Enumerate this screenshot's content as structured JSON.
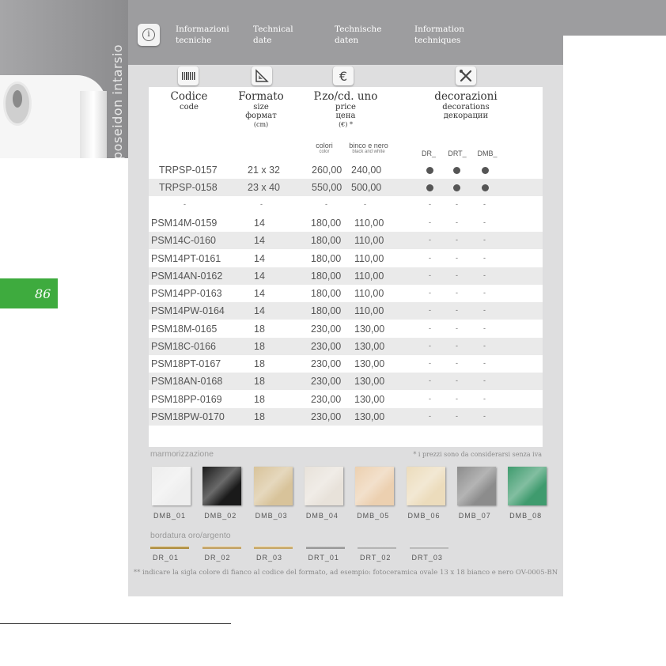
{
  "side": {
    "title": "poseidon intarsio"
  },
  "header": {
    "labels": [
      {
        "line1": "Informazioni",
        "line2": "tecniche"
      },
      {
        "line1": "Technical",
        "line2": "date"
      },
      {
        "line1": "Technische",
        "line2": "daten"
      },
      {
        "line1": "Information",
        "line2": "techniques"
      }
    ]
  },
  "columns": {
    "code": {
      "title": "Codice",
      "sub1": "code"
    },
    "format": {
      "title": "Formato",
      "sub1": "size",
      "sub2": "формат",
      "sub3": "(cm)"
    },
    "price": {
      "title": "P.zo/cd. uno",
      "sub1": "price",
      "sub2": "цена",
      "sub3": "(€) *",
      "colors_label": "colori",
      "colors_sub": "color",
      "bw_label": "binco e nero",
      "bw_sub": "black and white"
    },
    "decor": {
      "title": "decorazioni",
      "sub1": "decorations",
      "sub2": "декорации",
      "dr": "DR_",
      "drt": "DRT_",
      "dmb": "DMB_"
    }
  },
  "rows_top": [
    {
      "code": "TRPSP-0157",
      "size": "21 x 32",
      "color": "260,00",
      "bw": "240,00",
      "dr": true,
      "drt": true,
      "dmb": true
    },
    {
      "code": "TRPSP-0158",
      "size": "23 x 40",
      "color": "550,00",
      "bw": "500,00",
      "dr": true,
      "drt": true,
      "dmb": true
    }
  ],
  "dash": "-",
  "rows": [
    {
      "code": "PSM14M-0159",
      "size": "14",
      "color": "180,00",
      "bw": "110,00"
    },
    {
      "code": "PSM14C-0160",
      "size": "14",
      "color": "180,00",
      "bw": "110,00"
    },
    {
      "code": "PSM14PT-0161",
      "size": "14",
      "color": "180,00",
      "bw": "110,00"
    },
    {
      "code": "PSM14AN-0162",
      "size": "14",
      "color": "180,00",
      "bw": "110,00"
    },
    {
      "code": "PSM14PP-0163",
      "size": "14",
      "color": "180,00",
      "bw": "110,00"
    },
    {
      "code": "PSM14PW-0164",
      "size": "14",
      "color": "180,00",
      "bw": "110,00"
    },
    {
      "code": "PSM18M-0165",
      "size": "18",
      "color": "230,00",
      "bw": "130,00"
    },
    {
      "code": "PSM18C-0166",
      "size": "18",
      "color": "230,00",
      "bw": "130,00"
    },
    {
      "code": "PSM18PT-0167",
      "size": "18",
      "color": "230,00",
      "bw": "130,00"
    },
    {
      "code": "PSM18AN-0168",
      "size": "18",
      "color": "230,00",
      "bw": "130,00"
    },
    {
      "code": "PSM18PP-0169",
      "size": "18",
      "color": "230,00",
      "bw": "130,00"
    },
    {
      "code": "PSM18PW-0170",
      "size": "18",
      "color": "230,00",
      "bw": "130,00"
    }
  ],
  "iva_note": "* i prezzi sono da considerarsi senza iva",
  "marble": {
    "title": "marmorizzazione",
    "items": [
      {
        "label": "DMB_01",
        "color": "#eeeeee"
      },
      {
        "label": "DMB_02",
        "color": "#1a1a1a"
      },
      {
        "label": "DMB_03",
        "color": "#d8c39a"
      },
      {
        "label": "DMB_04",
        "color": "#e8e2da"
      },
      {
        "label": "DMB_05",
        "color": "#ecd0b0"
      },
      {
        "label": "DMB_06",
        "color": "#ecdcbc"
      },
      {
        "label": "DMB_07",
        "color": "#8c8c8c"
      },
      {
        "label": "DMB_08",
        "color": "#3f9b6e"
      }
    ]
  },
  "borders": {
    "title": "bordatura oro/argento",
    "items": [
      {
        "label": "DR_01",
        "color": "#b08f40"
      },
      {
        "label": "DR_02",
        "color": "#c3a264"
      },
      {
        "label": "DR_03",
        "color": "#c8a867"
      },
      {
        "label": "DRT_01",
        "color": "#9a9a9a"
      },
      {
        "label": "DRT_02",
        "color": "#b6b6b6"
      },
      {
        "label": "DRT_03",
        "color": "#bdbdbd"
      }
    ]
  },
  "footnote": "** indicare la sigla colore di fianco al codice del formato, ad esempio: fotoceramica ovale 13 x 18 bianco e nero OV-0005-BN",
  "page_number": "86",
  "colors": {
    "accent_green": "#3eab3e",
    "header_grey": "#9d9d9f",
    "panel_grey": "#dededf"
  }
}
